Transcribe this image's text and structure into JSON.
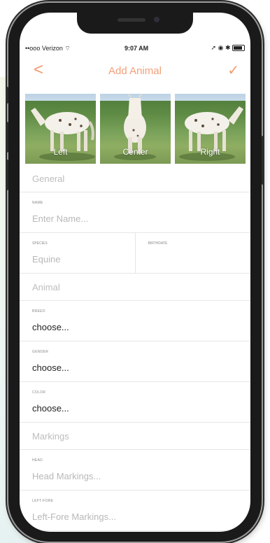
{
  "status_bar": {
    "carrier": "••ooo Verizon",
    "wifi_icon": "wifi-icon",
    "time": "9:07 AM",
    "right_icons": "➚ ◉ ✱",
    "battery_icon": "battery-icon"
  },
  "nav": {
    "back": "<",
    "title": "Add Animal",
    "done": "✓"
  },
  "photos": [
    {
      "label": "Left"
    },
    {
      "label": "Center"
    },
    {
      "label": "Right"
    }
  ],
  "form": {
    "general_header": "General",
    "name_label": "NAME",
    "name_placeholder": "Enter Name...",
    "species_label": "SPECIES",
    "species_value": "Equine",
    "birthdate_label": "BIRTHDATE",
    "animal_header": "Animal",
    "breed_label": "BREED",
    "breed_value": "choose...",
    "gender_label": "GENDER",
    "gender_value": "choose...",
    "color_label": "COLOR",
    "color_value": "choose...",
    "markings_header": "Markings",
    "head_label": "HEAD",
    "head_placeholder": "Head Markings...",
    "leftfore_label": "LEFT-FORE",
    "leftfore_placeholder": "Left-Fore Markings..."
  },
  "colors": {
    "accent": "#f29a6b",
    "phone_frame": "#1a1a1a"
  }
}
